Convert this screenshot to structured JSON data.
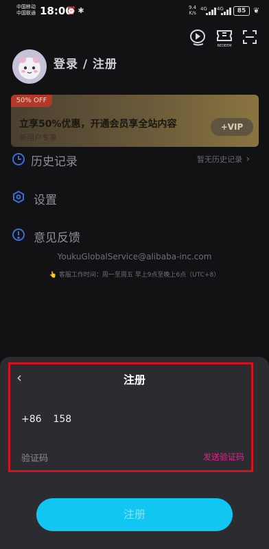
{
  "statusbar": {
    "carrier1": "中国移动",
    "carrier2": "中国联通",
    "time": "18:00",
    "speed_value": "9.4",
    "speed_unit": "K/s",
    "net1": "4G",
    "net2": "4G",
    "battery": "85"
  },
  "top_icons": {
    "redeem_label": "REDEEM"
  },
  "profile": {
    "login_label": "登录 / 注册"
  },
  "vip_card": {
    "badge": "50% OFF",
    "title": "立享50%优惠，开通会员享全站内容",
    "subtitle": "新用户专享",
    "button": "+VIP"
  },
  "menu": {
    "history": "历史记录",
    "history_right": "暂无历史记录",
    "settings": "设置",
    "feedback": "意见反馈"
  },
  "contact": {
    "email": "YoukuGlobalService@alibaba-inc.com",
    "hours": "客服工作时间：周一至周五 早上9点至晚上6点（UTC+8）"
  },
  "register_sheet": {
    "title": "注册",
    "country_code": "+86",
    "phone": "158",
    "code_placeholder": "验证码",
    "send_code": "发送验证码",
    "submit": "注册"
  },
  "colors": {
    "background": "#121214",
    "sheet": "#2c2c30",
    "accent_pink": "#e0248c",
    "primary_button": "#12c6f2",
    "highlight_box": "#d1141f"
  }
}
